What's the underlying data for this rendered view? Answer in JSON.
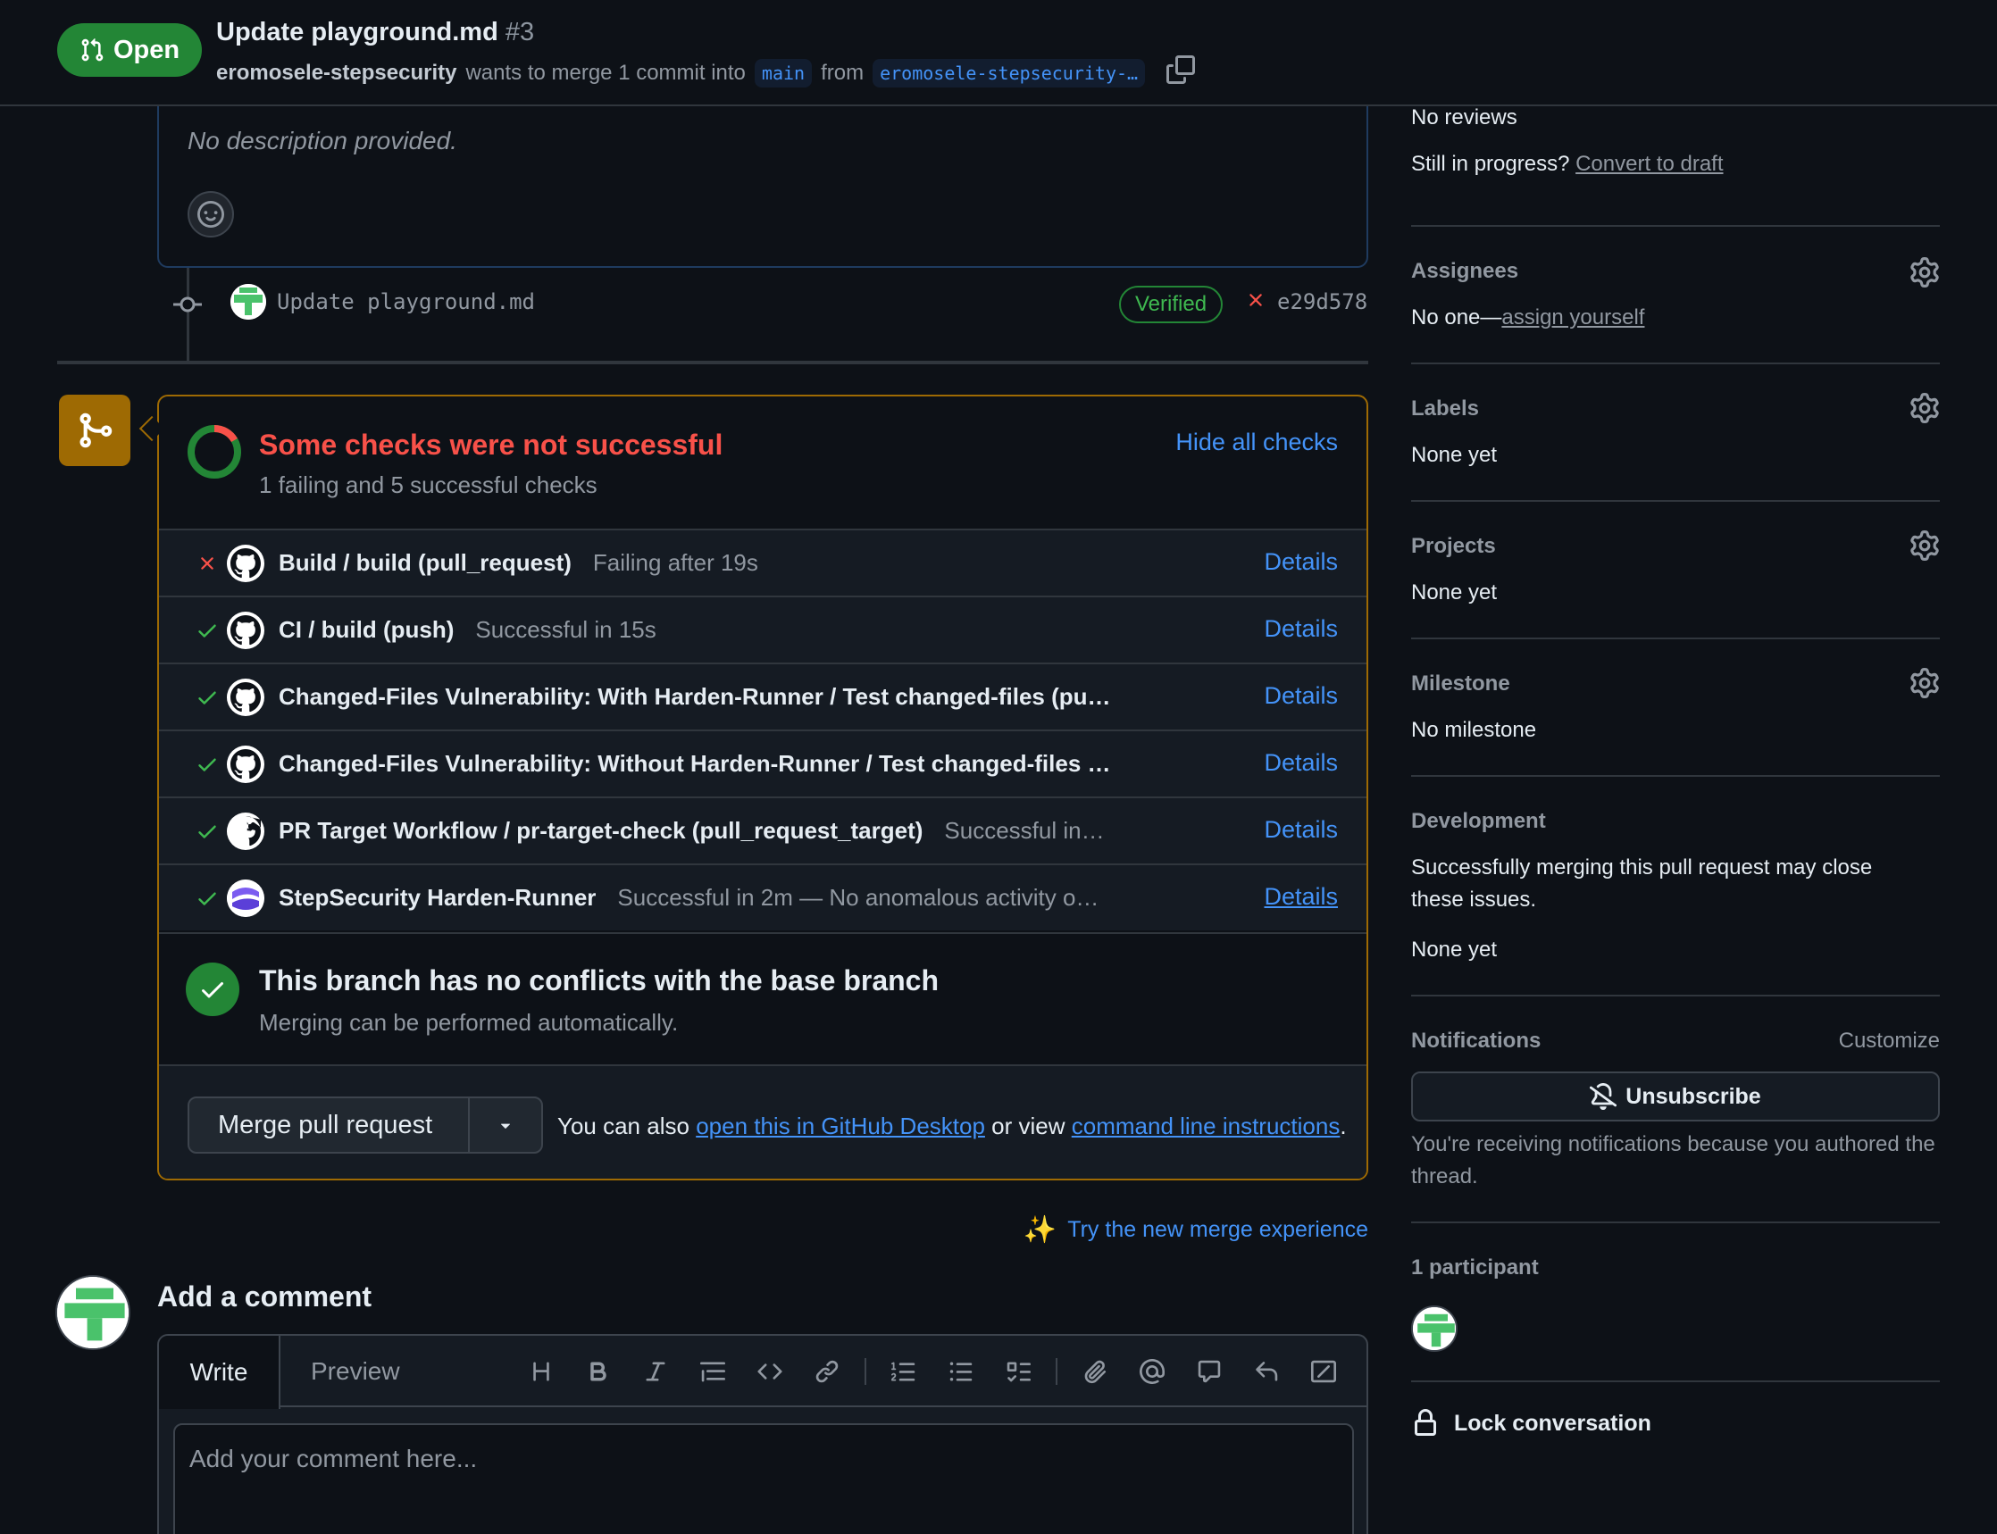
{
  "header": {
    "state": "Open",
    "title": "Update playground.md",
    "number": "#3",
    "author": "eromosele-stepsecurity",
    "merge_text": "wants to merge 1 commit into",
    "base_branch": "main",
    "from_text": "from",
    "head_branch": "eromosele-stepsecurity-…"
  },
  "description": {
    "text": "No description provided."
  },
  "commit": {
    "message": "Update playground.md",
    "verified": "Verified",
    "sha": "e29d578"
  },
  "checks": {
    "title": "Some checks were not successful",
    "subtitle": "1 failing and 5 successful checks",
    "hide_label": "Hide all checks",
    "details_label": "Details",
    "items": [
      {
        "status": "fail",
        "name": "Build / build (pull_request)",
        "desc": "Failing after 19s"
      },
      {
        "status": "pass",
        "name": "CI / build (push)",
        "desc": "Successful in 15s"
      },
      {
        "status": "pass",
        "name": "Changed-Files Vulnerability: With Harden-Runner / Test changed-files (pu…",
        "desc": ""
      },
      {
        "status": "pass",
        "name": "Changed-Files Vulnerability: Without Harden-Runner / Test changed-files …",
        "desc": ""
      },
      {
        "status": "pass",
        "name": "PR Target Workflow / pr-target-check (pull_request_target)",
        "desc": "Successful in…"
      },
      {
        "status": "pass",
        "name": "StepSecurity Harden-Runner",
        "desc": "Successful in 2m — No anomalous activity o…"
      }
    ]
  },
  "conflicts": {
    "title": "This branch has no conflicts with the base branch",
    "subtitle": "Merging can be performed automatically."
  },
  "merge": {
    "button_label": "Merge pull request",
    "also_text": "You can also",
    "desktop_link": "open this in GitHub Desktop",
    "or_view": "or view",
    "cli_link": "command line instructions",
    "period": ".",
    "try_new": "Try the new merge experience"
  },
  "comment": {
    "heading": "Add a comment",
    "tab_write": "Write",
    "tab_preview": "Preview",
    "placeholder": "Add your comment here..."
  },
  "sidebar": {
    "reviews": "No reviews",
    "in_progress": "Still in progress?",
    "convert_draft": "Convert to draft",
    "assignees_h": "Assignees",
    "assignees_v": "No one—",
    "assign_yourself": "assign yourself",
    "labels_h": "Labels",
    "labels_v": "None yet",
    "projects_h": "Projects",
    "projects_v": "None yet",
    "milestone_h": "Milestone",
    "milestone_v": "No milestone",
    "development_h": "Development",
    "development_text_1": "Successfully merging this pull request may close",
    "development_text_2": "these issues.",
    "development_v": "None yet",
    "notifications_h": "Notifications",
    "customize": "Customize",
    "unsubscribe": "Unsubscribe",
    "notif_note": "You're receiving notifications because you authored the thread.",
    "participants_h": "1 participant",
    "lock": "Lock conversation"
  },
  "colors": {
    "accent": "#4493f8",
    "success": "#238636",
    "danger": "#f85149",
    "warning": "#9e6a03"
  }
}
